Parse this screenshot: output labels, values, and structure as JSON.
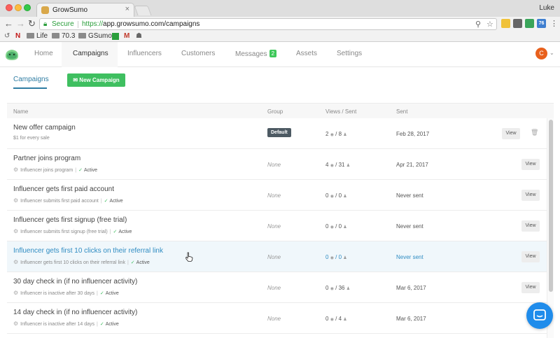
{
  "browser": {
    "tab_title": "GrowSumo",
    "user": "Luke",
    "secure_label": "Secure",
    "url_scheme": "https://",
    "url_rest": "app.growsumo.com/campaigns",
    "bookmarks": [
      "Life",
      "70.3",
      "GSumo"
    ],
    "extension_badge": "76"
  },
  "nav": {
    "items": [
      {
        "label": "Home"
      },
      {
        "label": "Campaigns"
      },
      {
        "label": "Influencers"
      },
      {
        "label": "Customers"
      },
      {
        "label": "Messages",
        "badge": "2"
      },
      {
        "label": "Assets"
      },
      {
        "label": "Settings"
      }
    ],
    "avatar_initial": "C"
  },
  "subheader": {
    "tab": "Campaigns",
    "new_campaign": "New Campaign"
  },
  "table": {
    "headers": {
      "name": "Name",
      "group": "Group",
      "views": "Views / Sent",
      "sent": "Sent"
    },
    "rows": [
      {
        "title": "New offer campaign",
        "subtitle": "$1 for every sale",
        "group": "Default",
        "views": "2",
        "sent_count": "8",
        "sent": "Feb 28, 2017",
        "action": "View"
      },
      {
        "title": "Partner joins program",
        "subtitle": "Influencer joins program",
        "status": "Active",
        "group": "None",
        "views": "4",
        "sent_count": "31",
        "sent": "Apr 21, 2017",
        "action": "View"
      },
      {
        "title": "Influencer gets first paid account",
        "subtitle": "Influencer submits first paid account",
        "status": "Active",
        "group": "None",
        "views": "0",
        "sent_count": "0",
        "sent": "Never sent",
        "action": "View"
      },
      {
        "title": "Influencer gets first signup (free trial)",
        "subtitle": "Influencer submits first signup (free trial)",
        "status": "Active",
        "group": "None",
        "views": "0",
        "sent_count": "0",
        "sent": "Never sent",
        "action": "View"
      },
      {
        "title": "Influencer gets first 10 clicks on their referral link",
        "subtitle": "Influencer gets first 10 clicks on their referral link",
        "status": "Active",
        "group": "None",
        "views": "0",
        "sent_count": "0",
        "sent": "Never sent",
        "action": "View"
      },
      {
        "title": "30 day check in (if no influencer activity)",
        "subtitle": "Influencer is inactive after 30 days",
        "status": "Active",
        "group": "None",
        "views": "0",
        "sent_count": "36",
        "sent": "Mar 6, 2017",
        "action": "View"
      },
      {
        "title": "14 day check in (if no influencer activity)",
        "subtitle": "Influencer is inactive after 14 days",
        "status": "Active",
        "group": "None",
        "views": "0",
        "sent_count": "4",
        "sent": "Mar 6, 2017",
        "action": "View"
      }
    ]
  },
  "colors": {
    "brand_green": "#3fbf60",
    "link_blue": "#2f8cc2",
    "highlight_row": "#f0f7fb",
    "avatar": "#e8601c",
    "chat": "#1f8ceb"
  },
  "icons": [
    "gear-icon",
    "check-icon",
    "eye-icon",
    "person-icon",
    "trash-icon",
    "chat-icon",
    "envelope-icon"
  ]
}
